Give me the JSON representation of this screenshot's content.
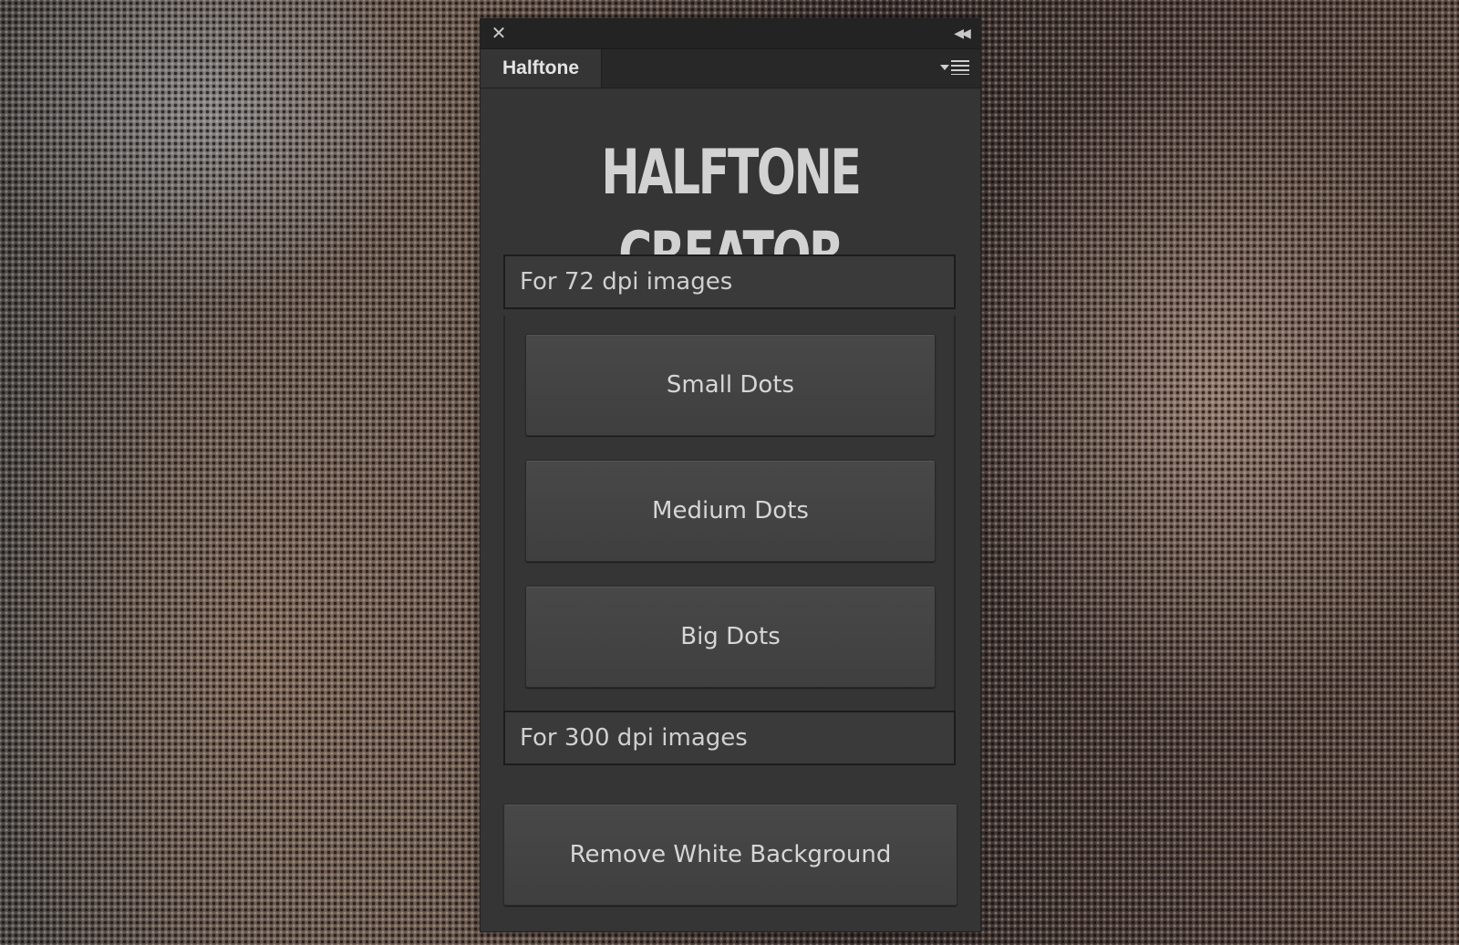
{
  "panel": {
    "tab_label": "Halftone",
    "close_glyph": "✕",
    "collapse_glyph": "◀◀",
    "heading": "HALFTONE CREATOR"
  },
  "sections": {
    "dpi72_label": "For 72 dpi images",
    "dpi300_label": "For 300 dpi images"
  },
  "buttons": {
    "small_dots": "Small Dots",
    "medium_dots": "Medium Dots",
    "big_dots": "Big Dots",
    "remove_white_background": "Remove White Background"
  },
  "colors": {
    "panel_bg": "#353535",
    "titlebar_bg": "#232323",
    "heading_text": "#d2d2d2",
    "button_bg": "#444444"
  },
  "icons": {
    "close": "close-icon",
    "collapse": "double-chevron-left-icon",
    "panel_menu": "panel-menu-icon"
  }
}
